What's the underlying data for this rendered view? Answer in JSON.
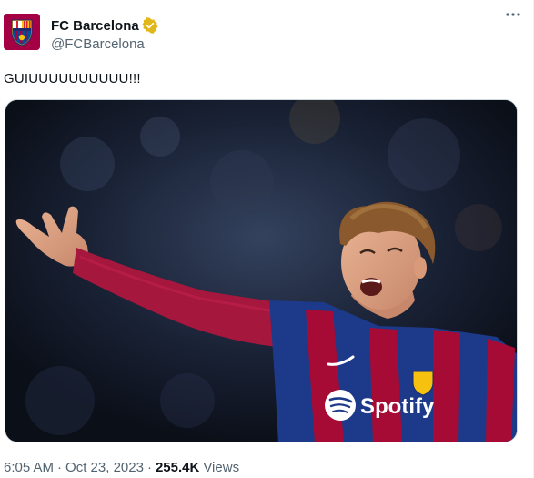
{
  "account": {
    "display_name": "FC Barcelona",
    "handle": "@FCBarcelona",
    "verified_icon": "gold-verified-badge",
    "avatar_icon": "fc-barcelona-crest"
  },
  "tweet": {
    "text": "GUIUUUUUUUUUU!!!",
    "more_icon": "more-options-icon"
  },
  "media": {
    "shirt_sponsor": "Spotify"
  },
  "meta": {
    "time": "6:05 AM",
    "separator": "·",
    "date": "Oct 23, 2023",
    "views_count": "255.4K",
    "views_label": "Views"
  },
  "colors": {
    "brand_blue": "#1d9bf0",
    "verified_gold": "#e2b719",
    "text_primary": "#0f1419",
    "text_secondary": "#536471",
    "barca_garnet": "#a50044",
    "barca_blue": "#004d98"
  }
}
